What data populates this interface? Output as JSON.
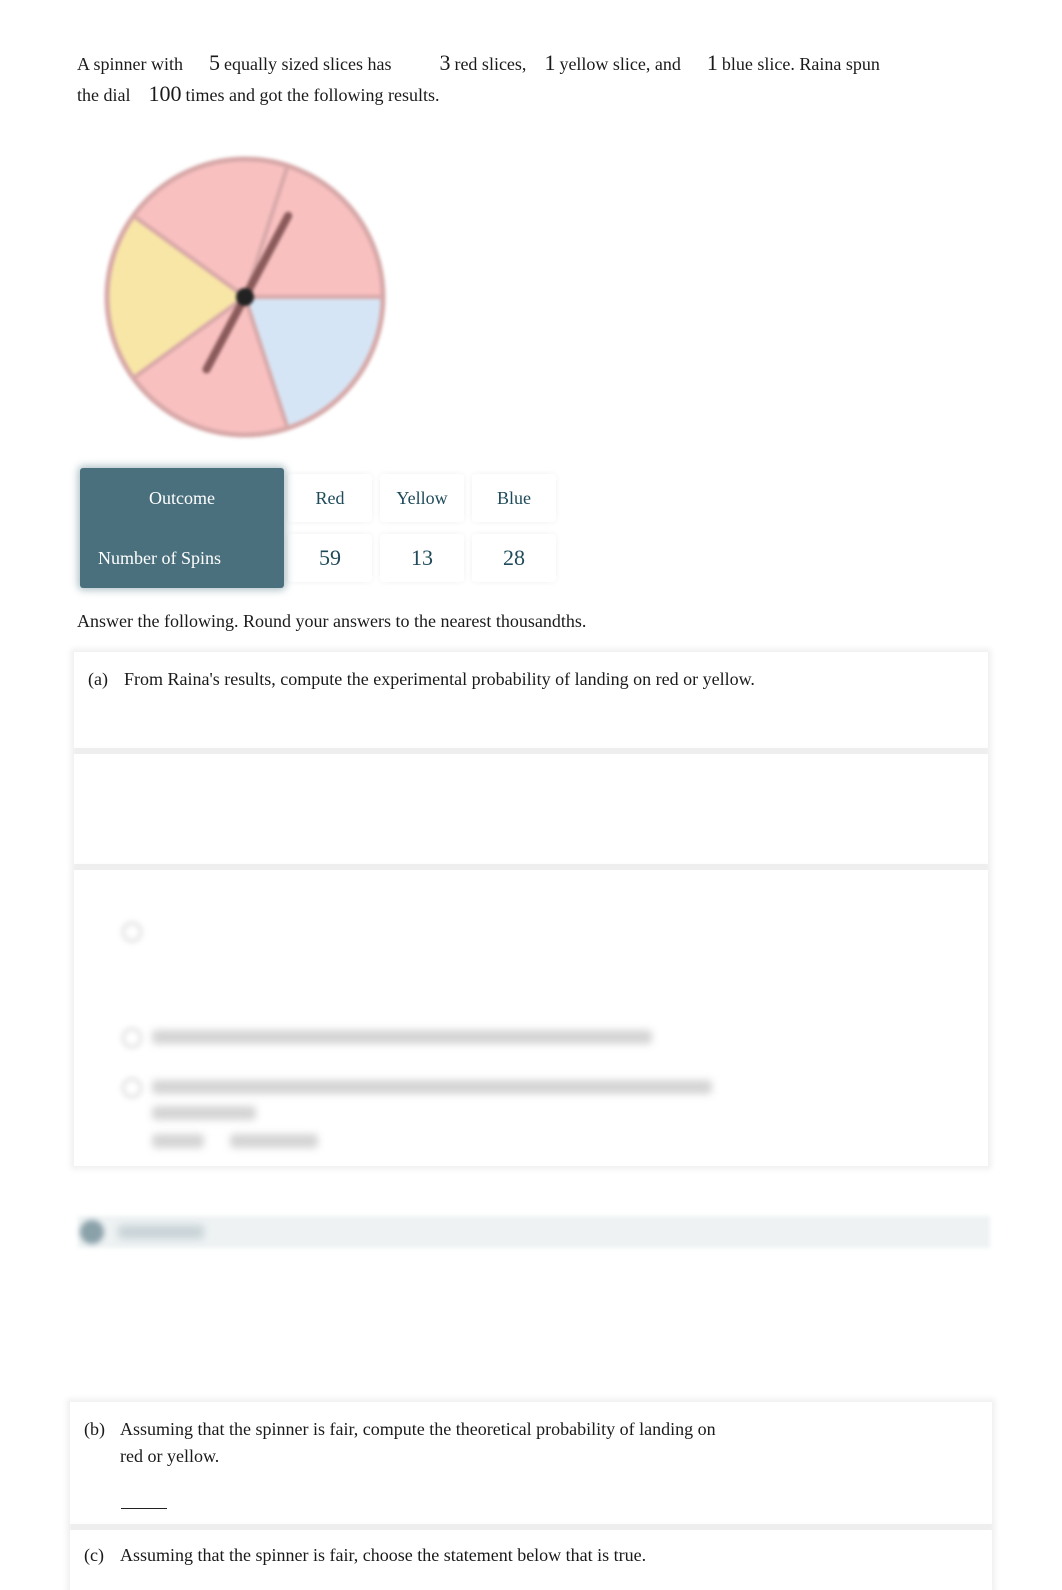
{
  "intro": {
    "t1": "A spinner with",
    "total_slices": "5",
    "t2": "equally sized slices has",
    "red_slices": "3",
    "t3": "red slices,",
    "yellow_slices": "1",
    "t4": "yellow slice, and",
    "blue_slices": "1",
    "t5": "blue slice. Raina spun",
    "t6": "the dial",
    "spins": "100",
    "t7": "times and got the following results."
  },
  "spinner": {
    "slices": [
      {
        "color": "red",
        "fill": "#f9c0c0"
      },
      {
        "color": "red",
        "fill": "#f9c0c0"
      },
      {
        "color": "yellow",
        "fill": "#f8e6a6"
      },
      {
        "color": "red",
        "fill": "#f9c0c0"
      },
      {
        "color": "blue",
        "fill": "#d6e5f5"
      }
    ],
    "outline_color": "#d7a8a8",
    "needle_color": "#8a5a5a",
    "hub_color": "#222222"
  },
  "table": {
    "row1_header": "Outcome",
    "row2_header": "Number of Spins",
    "outcomes": [
      "Red",
      "Yellow",
      "Blue"
    ],
    "counts": [
      "59",
      "13",
      "28"
    ]
  },
  "instructions": "Answer the following. Round your answers to the nearest thousandths.",
  "questions": {
    "a": {
      "letter": "(a)",
      "text": "From Raina's results, compute the experimental probability of landing on red or yellow."
    },
    "b": {
      "letter": "(b)",
      "text": "Assuming that the spinner is fair, compute the theoretical probability of landing on red or yellow."
    },
    "c": {
      "letter": "(c)",
      "text": "Assuming that the spinner is fair, choose the statement below that is true."
    }
  },
  "colors": {
    "table_header_bg": "#4a707e",
    "table_text": "#1e4a5a"
  }
}
